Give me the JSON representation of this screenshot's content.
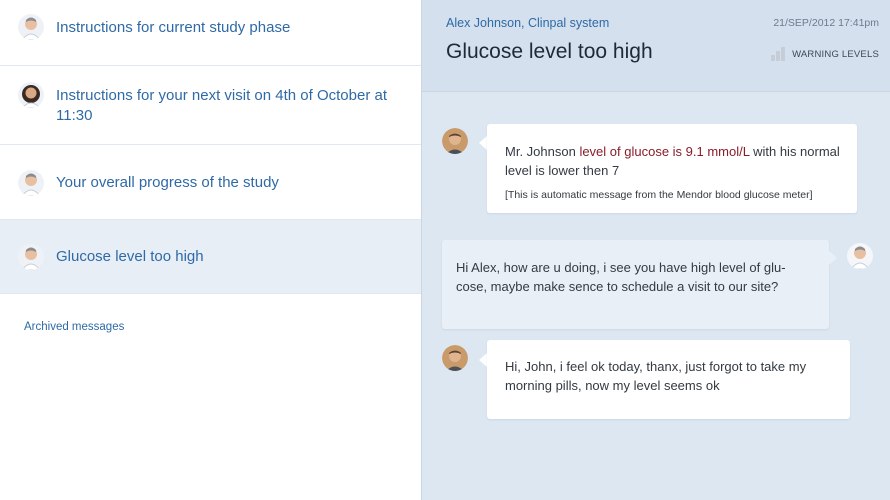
{
  "inbox": {
    "items": [
      {
        "title": "Instructions for current study phase",
        "avatar": "doctor-avatar"
      },
      {
        "title": "Instructions for your next visit on 4th of October at 11:30",
        "avatar": "nurse-avatar"
      },
      {
        "title": "Your overall progress of the study",
        "avatar": "doctor-avatar"
      },
      {
        "title": "Glucose level too high",
        "avatar": "doctor-avatar",
        "active": true
      }
    ],
    "archived_label": "Archived messages"
  },
  "message": {
    "from": "Alex Johnson, Clinpal system",
    "date": "21/SEP/2012 17:41pm",
    "subject": "Glucose level too high",
    "warning_label": "WARNING LEVELS",
    "warning_icon": "bar-chart-icon"
  },
  "conversation": [
    {
      "sender": "patient",
      "pre": "Mr. Johnson ",
      "highlight": "level of glucose is 9.1 mmol/L",
      "post": " with his normal level is lower then 7",
      "note": "[This is automatic message from the Mendor blood glucose meter]"
    },
    {
      "sender": "doctor",
      "text": "Hi Alex, how are u doing, i see you have high level of glu-cose, maybe make sence to schedule a visit to our site?"
    },
    {
      "sender": "patient",
      "text": "Hi, John, i feel ok today, thanx, just forgot to take my morning pills, now my level seems ok"
    }
  ],
  "colors": {
    "link_blue": "#2f6aa6",
    "highlight_red": "#8a1c28",
    "panel_blue": "#dde7f2"
  }
}
